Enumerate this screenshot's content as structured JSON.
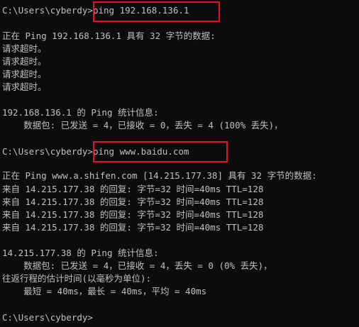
{
  "window": {
    "background": "#0c0c0c",
    "text_color": "#c0c0c0",
    "highlight_color": "#e81123"
  },
  "console": {
    "block1": {
      "prompt": "C:\\Users\\cyberdy>",
      "command": "ping 192.168.136.1",
      "header": "正在 Ping 192.168.136.1 具有 32 字节的数据:",
      "replies": [
        "请求超时。",
        "请求超时。",
        "请求超时。",
        "请求超时。"
      ],
      "stats_title": "192.168.136.1 的 Ping 统计信息:",
      "stats_packets": "    数据包: 已发送 = 4，已接收 = 0，丢失 = 4 (100% 丢失)，"
    },
    "block2": {
      "prompt": "C:\\Users\\cyberdy>",
      "command": "ping www.baidu.com",
      "header": "正在 Ping www.a.shifen.com [14.215.177.38] 具有 32 字节的数据:",
      "replies": [
        "来自 14.215.177.38 的回复: 字节=32 时间=40ms TTL=128",
        "来自 14.215.177.38 的回复: 字节=32 时间=40ms TTL=128",
        "来自 14.215.177.38 的回复: 字节=32 时间=40ms TTL=128",
        "来自 14.215.177.38 的回复: 字节=32 时间=40ms TTL=128"
      ],
      "stats_title": "14.215.177.38 的 Ping 统计信息:",
      "stats_packets": "    数据包: 已发送 = 4，已接收 = 4，丢失 = 0 (0% 丢失)，",
      "rtt_title": "往返行程的估计时间(以毫秒为单位):",
      "rtt_values": "    最短 = 40ms，最长 = 40ms，平均 = 40ms"
    },
    "final_prompt": "C:\\Users\\cyberdy>"
  }
}
